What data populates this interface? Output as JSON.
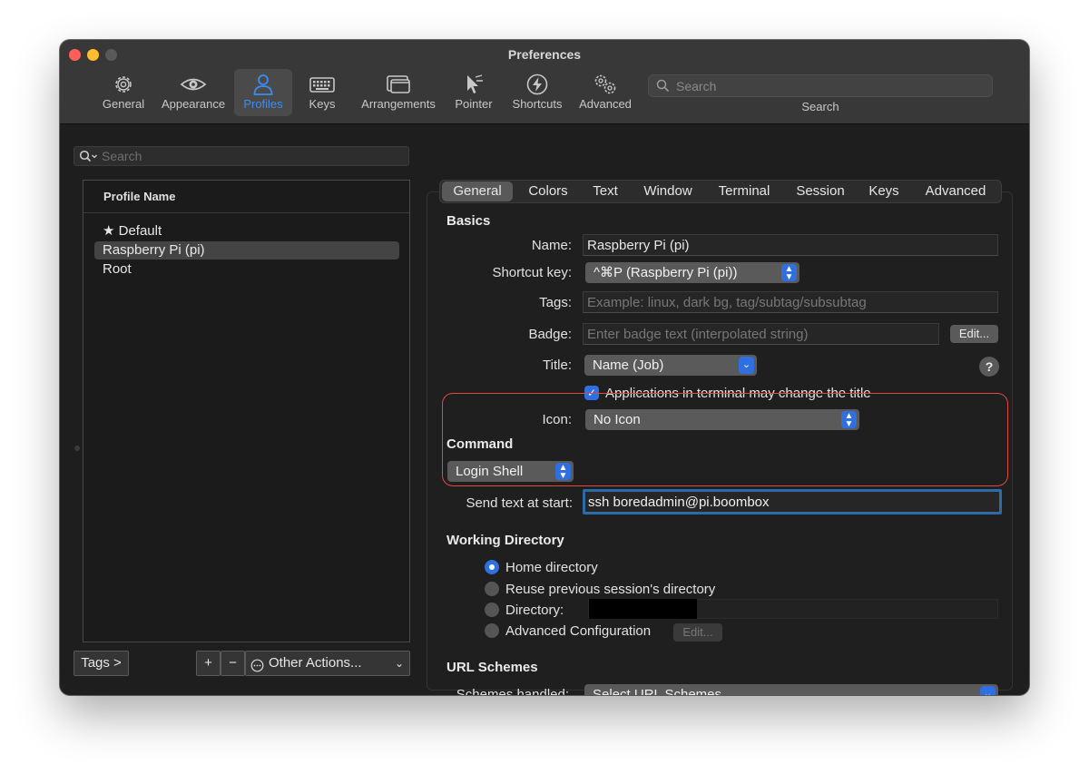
{
  "window": {
    "title": "Preferences"
  },
  "toolbar": {
    "items": [
      {
        "label": "General",
        "icon": "gear-icon"
      },
      {
        "label": "Appearance",
        "icon": "eye-icon"
      },
      {
        "label": "Profiles",
        "icon": "person-icon"
      },
      {
        "label": "Keys",
        "icon": "keyboard-icon"
      },
      {
        "label": "Arrangements",
        "icon": "windows-icon"
      },
      {
        "label": "Pointer",
        "icon": "cursor-icon"
      },
      {
        "label": "Shortcuts",
        "icon": "bolt-icon"
      },
      {
        "label": "Advanced",
        "icon": "gears-icon"
      }
    ],
    "active": "Profiles",
    "search_placeholder": "Search",
    "search_caption": "Search"
  },
  "profiles": {
    "search_placeholder": "Search",
    "header": "Profile Name",
    "items": [
      "★ Default",
      "Raspberry Pi (pi)",
      "Root"
    ],
    "selected": "Raspberry Pi (pi)",
    "tags_button": "Tags >",
    "add_button": "+",
    "remove_button": "−",
    "other_actions": "Other Actions..."
  },
  "tabs": [
    "General",
    "Colors",
    "Text",
    "Window",
    "Terminal",
    "Session",
    "Keys",
    "Advanced"
  ],
  "active_tab": "General",
  "basics": {
    "title": "Basics",
    "name_label": "Name:",
    "name_value": "Raspberry Pi (pi)",
    "shortcut_label": "Shortcut key:",
    "shortcut_value": "^⌘P (Raspberry Pi (pi))",
    "tags_label": "Tags:",
    "tags_placeholder": "Example: linux, dark bg, tag/subtag/subsubtag",
    "badge_label": "Badge:",
    "badge_placeholder": "Enter badge text (interpolated string)",
    "badge_edit": "Edit...",
    "title_label": "Title:",
    "title_value": "Name (Job)",
    "help": "?",
    "apps_checkbox_label": "Applications in terminal may change the title",
    "apps_checkbox_checked": true,
    "icon_label": "Icon:",
    "icon_value": "No Icon"
  },
  "command": {
    "title": "Command",
    "shell_value": "Login Shell",
    "send_text_label": "Send text at start:",
    "send_text_value": "ssh boredadmin@pi.boombox",
    "highlight_color": "#e2483f"
  },
  "working_directory": {
    "title": "Working Directory",
    "options": [
      "Home directory",
      "Reuse previous session's directory",
      "Directory:",
      "Advanced Configuration"
    ],
    "selected": "Home directory",
    "advanced_edit": "Edit..."
  },
  "url_schemes": {
    "title": "URL Schemes",
    "label": "Schemes handled:",
    "value": "Select URL Schemes..."
  },
  "colors": {
    "accent": "#2f6fe0",
    "active_toolbar": "#3b8cf5",
    "background": "#1e1e1e"
  }
}
